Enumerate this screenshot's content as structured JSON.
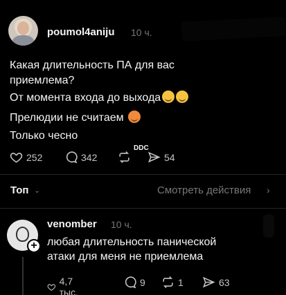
{
  "post": {
    "username": "poumol4aniju",
    "time": "10 ч.",
    "lines": [
      "Какая длительность ПА для вас",
      "приемлема?",
      "От момента входа до выхода",
      "Прелюдии не считаем",
      "Только чесно"
    ],
    "emoji_line3": [
      "smirk-emoji",
      "smiling-emoji"
    ],
    "emoji_line4": "smiling-hearts-emoji",
    "likes": "252",
    "comments": "342",
    "reposts_label": "DDC",
    "shares": "54"
  },
  "sort": {
    "label": "Топ",
    "view_activity": "Смотреть действия"
  },
  "reply": {
    "username": "venomber",
    "time": "10 ч.",
    "lines": [
      "любая длительность панической",
      "атаки для меня не приемлема"
    ],
    "likes": "4,7 тыс.",
    "comments": "9",
    "reposts": "1",
    "shares": "63"
  },
  "colors": {
    "background": "#000000",
    "text": "#f3f5f7",
    "muted": "#777777"
  }
}
